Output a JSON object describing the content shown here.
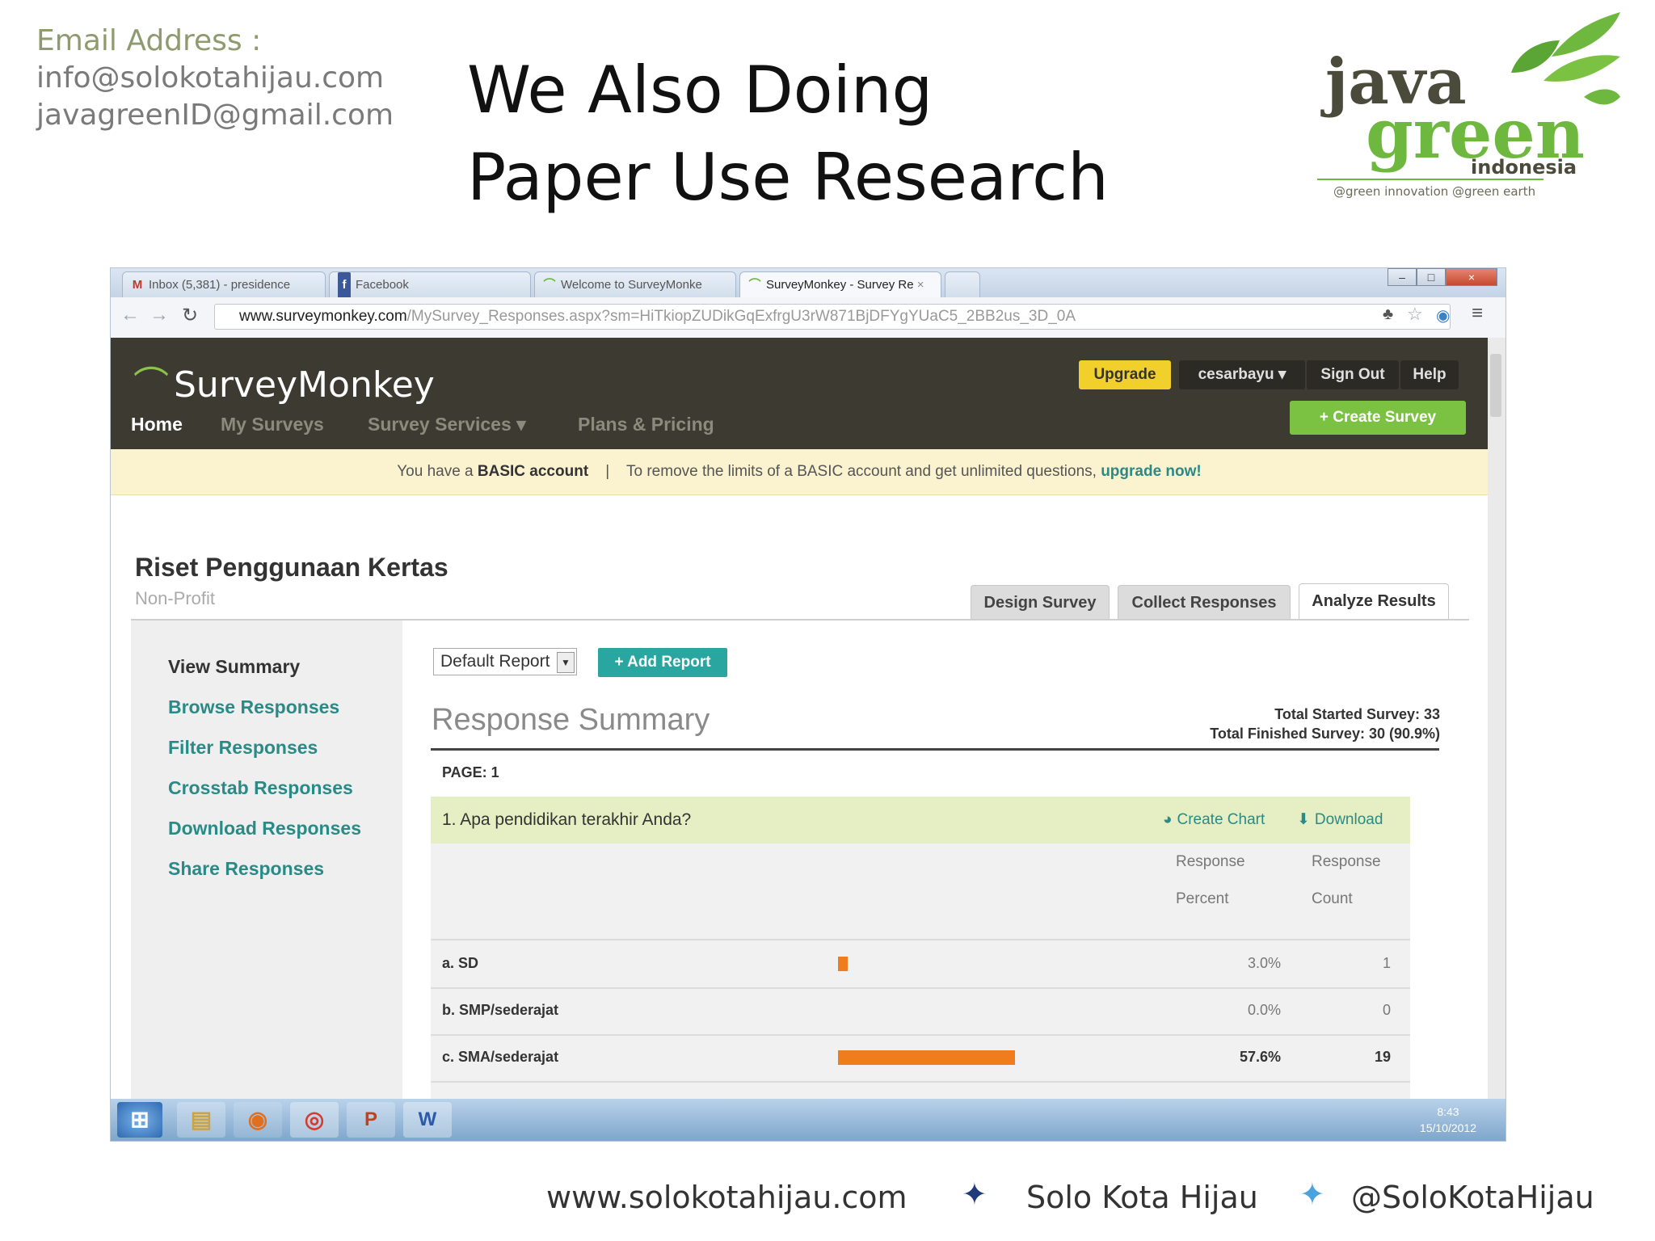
{
  "slide": {
    "email_label": "Email Address :",
    "emails": [
      "info@solokotahijau.com",
      "javagreenID@gmail.com"
    ],
    "title_line1": "We Also Doing",
    "title_line2": "Paper Use Research",
    "logo": {
      "word1": "java",
      "word2": "green",
      "word3": "indonesia",
      "tagline": "@green innovation @green earth"
    },
    "footer": {
      "website": "www.solokotahijau.com",
      "facebook": "Solo Kota Hijau",
      "twitter": "@SoloKotaHijau"
    }
  },
  "browser": {
    "tabs": [
      {
        "label": "Inbox (5,381) - presidence",
        "icon": "gmail-icon"
      },
      {
        "label": "Facebook",
        "icon": "facebook-icon"
      },
      {
        "label": "Welcome to SurveyMonke",
        "icon": "surveymonkey-icon"
      },
      {
        "label": "SurveyMonkey - Survey Re",
        "icon": "surveymonkey-icon"
      }
    ],
    "url_host": "www.surveymonkey.com",
    "url_path": "/MySurvey_Responses.aspx?sm=HiTkiopZUDikGqExfrgU3rW871BjDFYgYUaC5_2BB2us_3D_0A"
  },
  "app": {
    "brand": "SurveyMonkey",
    "header_buttons": {
      "upgrade": "Upgrade",
      "user": "cesarbayu",
      "signout": "Sign Out",
      "help": "Help"
    },
    "create_survey": "+ Create Survey",
    "nav": [
      "Home",
      "My Surveys",
      "Survey Services",
      "Plans & Pricing"
    ],
    "notice": {
      "pre": "You have a ",
      "account": "BASIC account",
      "sep": "|",
      "msg": "To remove the limits of a BASIC account and get unlimited questions, ",
      "link": "upgrade now!"
    },
    "survey": {
      "title": "Riset Penggunaan Kertas",
      "category": "Non-Profit"
    },
    "analyze_tabs": [
      "Design Survey",
      "Collect Responses",
      "Analyze Results"
    ],
    "sidebar": [
      "View Summary",
      "Browse Responses",
      "Filter Responses",
      "Crosstab Responses",
      "Download Responses",
      "Share Responses"
    ],
    "report_select": "Default Report",
    "add_report": "+ Add Report",
    "summary_title": "Response Summary",
    "total_started": "Total Started Survey: 33",
    "total_finished": "Total Finished Survey: 30  (90.9%)",
    "page_label": "PAGE: 1",
    "question": "1. Apa pendidikan terakhir Anda?",
    "create_chart": "Create Chart",
    "download": "Download",
    "col_percent": [
      "Response",
      "Percent"
    ],
    "col_count": [
      "Response",
      "Count"
    ],
    "rows": [
      {
        "label": "a. SD",
        "percent": "3.0%",
        "count": "1",
        "value": 3.0
      },
      {
        "label": "b. SMP/sederajat",
        "percent": "0.0%",
        "count": "0",
        "value": 0.0
      },
      {
        "label": "c. SMA/sederajat",
        "percent": "57.6%",
        "count": "19",
        "value": 57.6
      }
    ],
    "bar_color": "#ef7d1e"
  },
  "taskbar": {
    "time": "8:43",
    "date": "15/10/2012"
  }
}
